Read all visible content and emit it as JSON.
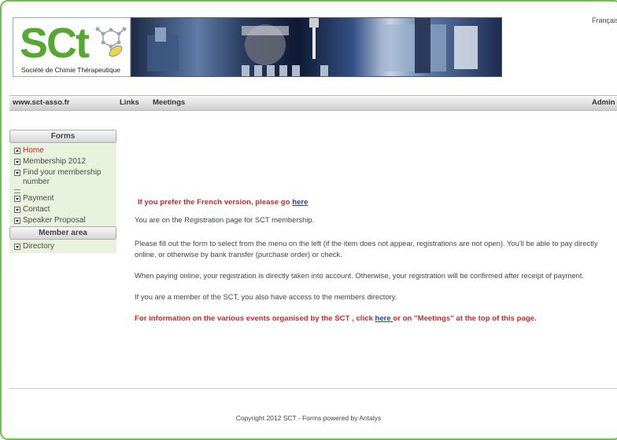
{
  "language_link": "Français",
  "logo": {
    "text": "SCt",
    "subtitle": "Société de Chimie Thérapeutique"
  },
  "navbar": {
    "site": "www.sct-asso.fr",
    "links": "Links",
    "meetings": "Meetings",
    "admin": "Admin"
  },
  "sidebar": {
    "forms_header": "Forms",
    "items": [
      {
        "label": "Home",
        "active": true
      },
      {
        "label": "Membership 2012"
      },
      {
        "label": "Find your membership number"
      },
      {
        "label": "Payment"
      },
      {
        "label": "Contact"
      },
      {
        "label": "Speaker Proposal"
      }
    ],
    "member_header": "Member area",
    "member_items": [
      {
        "label": "Directory"
      }
    ]
  },
  "main": {
    "french_prefix": "If you prefer the French version, please go ",
    "french_link": "here",
    "intro": "You are on the Registration page for SCT membership.",
    "para1": "Please fill out the form to select from the menu on the left (if the item does not appear, registrations are not open). You'll be able to pay directly online, or otherwise by bank transfer (purchase order) or check.",
    "para2": "When paying online, your registration is directly taken into account. Otherwise, your registration will be confirmed after receipt of payment.",
    "para3": "If you are a member of the SCT, you also have access to the members directory.",
    "events_prefix": "For information on the various events organised by the SCT , click ",
    "events_link": "here ",
    "events_suffix": "or on \"Meetings\" at the top of this page."
  },
  "footer": {
    "text": "Copyright 2012 SCT   -   Forms powered by Antalys"
  },
  "colors": {
    "brand_green": "#56a830",
    "accent_red": "#d9241f",
    "link_blue": "#1a3fbf"
  }
}
